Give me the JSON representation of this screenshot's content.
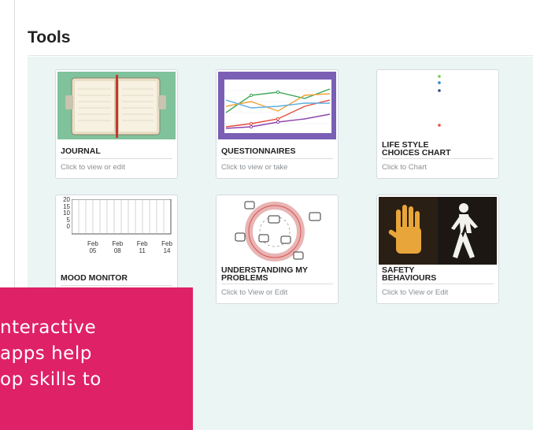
{
  "page": {
    "title": "Tools"
  },
  "cards": [
    {
      "title": "JOURNAL",
      "subtitle": "Click to view or edit",
      "icon": "journal-book-icon"
    },
    {
      "title": "QUESTIONNAIRES",
      "subtitle": "Click to view or take",
      "icon": "line-chart-icon"
    },
    {
      "title": "LIFE STYLE\nCHOICES CHART",
      "subtitle": "Click to Chart",
      "icon": "dot-chart-icon"
    },
    {
      "title": "MOOD MONITOR",
      "subtitle": "",
      "icon": "mood-chart-icon",
      "chart": {
        "y_ticks": [
          "20",
          "15",
          "10",
          "5",
          "0"
        ],
        "x_ticks": [
          "Feb\n05",
          "Feb\n08",
          "Feb\n11",
          "Feb\n14"
        ]
      }
    },
    {
      "title": "UNDERSTANDING MY\nPROBLEMS",
      "subtitle": "Click to View or Edit",
      "icon": "cycle-diagram-icon"
    },
    {
      "title": "SAFETY\nBEHAVIOURS",
      "subtitle": "Click to View or Edit",
      "icon": "crossing-signal-icon"
    }
  ],
  "overlay": {
    "text": "nteractive\napps help\nop skills to"
  },
  "colors": {
    "panel": "#eaf5f4",
    "overlay": "#df2167",
    "questionnaire_bg": "#7a5fb4"
  }
}
